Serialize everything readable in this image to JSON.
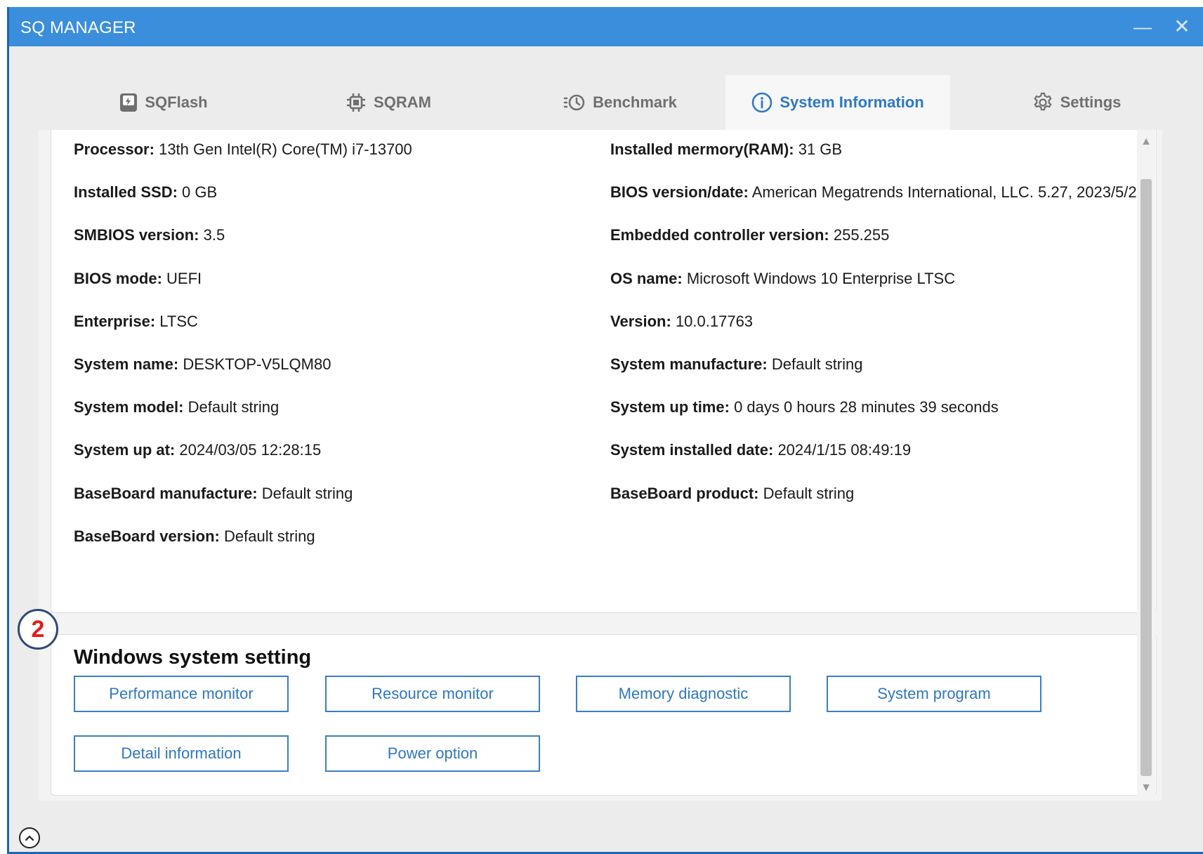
{
  "window": {
    "title": "SQ MANAGER",
    "minimize_glyph": "—",
    "close_glyph": "✕"
  },
  "tabs": [
    {
      "label": "SQFlash",
      "icon": "sqflash-icon"
    },
    {
      "label": "SQRAM",
      "icon": "chip-icon"
    },
    {
      "label": "Benchmark",
      "icon": "benchmark-clock-icon"
    },
    {
      "label": "System Information",
      "icon": "info-icon",
      "active": true
    },
    {
      "label": "Settings",
      "icon": "gear-icon"
    }
  ],
  "system_info": {
    "left": [
      {
        "label": "Processor:",
        "value": "13th Gen Intel(R) Core(TM) i7-13700"
      },
      {
        "label": "Installed SSD:",
        "value": "0 GB"
      },
      {
        "label": "SMBIOS version:",
        "value": "3.5"
      },
      {
        "label": "BIOS mode:",
        "value": "UEFI"
      },
      {
        "label": "Enterprise:",
        "value": "LTSC"
      },
      {
        "label": "System name:",
        "value": "DESKTOP-V5LQM80"
      },
      {
        "label": "System model:",
        "value": "Default string"
      },
      {
        "label": "System up at:",
        "value": "2024/03/05 12:28:15"
      },
      {
        "label": "BaseBoard manufacture:",
        "value": "Default string"
      },
      {
        "label": "BaseBoard version:",
        "value": "Default string"
      }
    ],
    "right": [
      {
        "label": "Installed mermory(RAM):",
        "value": "31 GB"
      },
      {
        "label": "BIOS version/date:",
        "value": "American Megatrends International, LLC. 5.27, 2023/5/2"
      },
      {
        "label": "Embedded controller version:",
        "value": "255.255"
      },
      {
        "label": "OS name:",
        "value": "Microsoft Windows 10 Enterprise LTSC"
      },
      {
        "label": "Version:",
        "value": "10.0.17763"
      },
      {
        "label": "System manufacture:",
        "value": "Default string"
      },
      {
        "label": "System up time:",
        "value": "0 days 0 hours 28 minutes 39 seconds"
      },
      {
        "label": "System installed date:",
        "value": "2024/1/15  08:49:19"
      },
      {
        "label": "BaseBoard product:",
        "value": "Default string"
      }
    ]
  },
  "windows_settings": {
    "title": "Windows system setting",
    "buttons": [
      "Performance monitor",
      "Resource monitor",
      "Memory diagnostic",
      "System program",
      "Detail information",
      "Power option"
    ]
  },
  "badge": {
    "number": "2"
  },
  "colors": {
    "titlebar": "#3a8edc",
    "accent": "#2d79c7",
    "badge_text": "#e21e1e",
    "badge_border": "#2e4a78"
  }
}
